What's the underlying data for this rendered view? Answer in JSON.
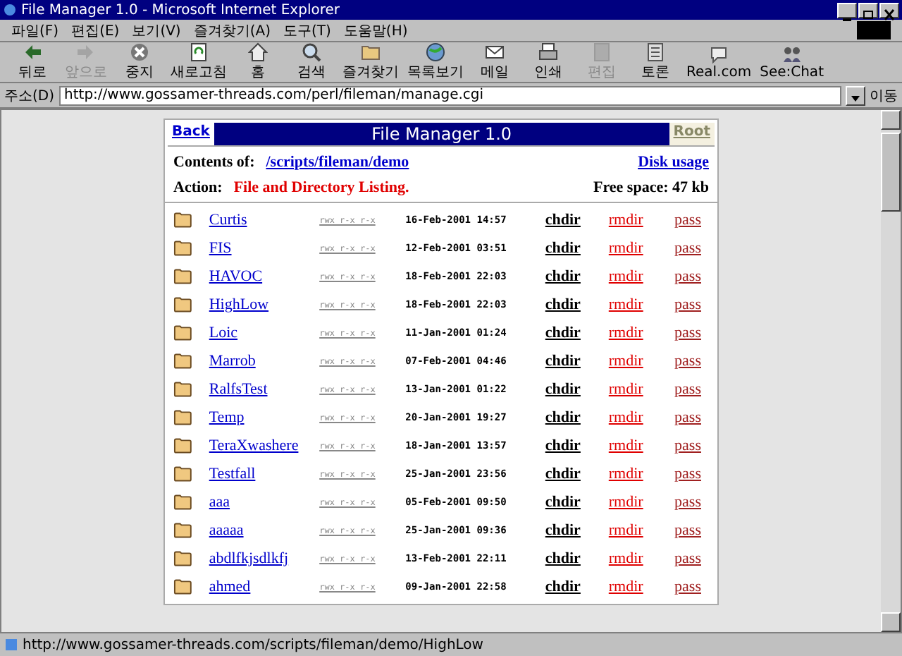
{
  "window": {
    "title": "File Manager 1.0 - Microsoft Internet Explorer"
  },
  "menu": [
    "파일(F)",
    "편집(E)",
    "보기(V)",
    "즐겨찾기(A)",
    "도구(T)",
    "도움말(H)"
  ],
  "toolbar": [
    {
      "label": "뒤로",
      "disabled": false
    },
    {
      "label": "앞으로",
      "disabled": true
    },
    {
      "label": "중지",
      "disabled": false
    },
    {
      "label": "새로고침",
      "disabled": false
    },
    {
      "label": "홈",
      "disabled": false
    },
    {
      "label": "검색",
      "disabled": false
    },
    {
      "label": "즐겨찾기",
      "disabled": false
    },
    {
      "label": "목록보기",
      "disabled": false
    },
    {
      "label": "메일",
      "disabled": false
    },
    {
      "label": "인쇄",
      "disabled": false
    },
    {
      "label": "편집",
      "disabled": true
    },
    {
      "label": "토론",
      "disabled": false
    },
    {
      "label": "Real.com",
      "disabled": false
    },
    {
      "label": "See:Chat",
      "disabled": false
    }
  ],
  "address": {
    "label": "주소(D)",
    "value": "http://www.gossamer-threads.com/perl/fileman/manage.cgi",
    "go": "이동"
  },
  "page": {
    "back": "Back",
    "title": "File Manager 1.0",
    "root": "Root",
    "contents_label": "Contents of:",
    "contents_path": "/scripts/fileman/demo",
    "disk_usage": "Disk usage",
    "action_label": "Action:",
    "action": "File and Directory Listing.",
    "free_space": "Free space: 47 kb"
  },
  "rows": [
    {
      "name": "Curtis",
      "perms": "rwx r-x r-x",
      "date": "16-Feb-2001 14:57",
      "chdir": "chdir",
      "rmdir": "rmdir",
      "pass": "pass"
    },
    {
      "name": "FIS",
      "perms": "rwx r-x r-x",
      "date": "12-Feb-2001 03:51",
      "chdir": "chdir",
      "rmdir": "rmdir",
      "pass": "pass"
    },
    {
      "name": "HAVOC",
      "perms": "rwx r-x r-x",
      "date": "18-Feb-2001 22:03",
      "chdir": "chdir",
      "rmdir": "rmdir",
      "pass": "pass"
    },
    {
      "name": "HighLow",
      "perms": "rwx r-x r-x",
      "date": "18-Feb-2001 22:03",
      "chdir": "chdir",
      "rmdir": "rmdir",
      "pass": "pass"
    },
    {
      "name": "Loic",
      "perms": "rwx r-x r-x",
      "date": "11-Jan-2001 01:24",
      "chdir": "chdir",
      "rmdir": "rmdir",
      "pass": "pass"
    },
    {
      "name": "Marrob",
      "perms": "rwx r-x r-x",
      "date": "07-Feb-2001 04:46",
      "chdir": "chdir",
      "rmdir": "rmdir",
      "pass": "pass"
    },
    {
      "name": "RalfsTest",
      "perms": "rwx r-x r-x",
      "date": "13-Jan-2001 01:22",
      "chdir": "chdir",
      "rmdir": "rmdir",
      "pass": "pass"
    },
    {
      "name": "Temp",
      "perms": "rwx r-x r-x",
      "date": "20-Jan-2001 19:27",
      "chdir": "chdir",
      "rmdir": "rmdir",
      "pass": "pass"
    },
    {
      "name": "TeraXwashere",
      "perms": "rwx r-x r-x",
      "date": "18-Jan-2001 13:57",
      "chdir": "chdir",
      "rmdir": "rmdir",
      "pass": "pass"
    },
    {
      "name": "Testfall",
      "perms": "rwx r-x r-x",
      "date": "25-Jan-2001 23:56",
      "chdir": "chdir",
      "rmdir": "rmdir",
      "pass": "pass"
    },
    {
      "name": "aaa",
      "perms": "rwx r-x r-x",
      "date": "05-Feb-2001 09:50",
      "chdir": "chdir",
      "rmdir": "rmdir",
      "pass": "pass"
    },
    {
      "name": "aaaaa",
      "perms": "rwx r-x r-x",
      "date": "25-Jan-2001 09:36",
      "chdir": "chdir",
      "rmdir": "rmdir",
      "pass": "pass"
    },
    {
      "name": "abdlfkjsdlkfj",
      "perms": "rwx r-x r-x",
      "date": "13-Feb-2001 22:11",
      "chdir": "chdir",
      "rmdir": "rmdir",
      "pass": "pass"
    },
    {
      "name": "ahmed",
      "perms": "rwx r-x r-x",
      "date": "09-Jan-2001 22:58",
      "chdir": "chdir",
      "rmdir": "rmdir",
      "pass": "pass"
    }
  ],
  "status_bar": {
    "text": "http://www.gossamer-threads.com/scripts/fileman/demo/HighLow"
  }
}
